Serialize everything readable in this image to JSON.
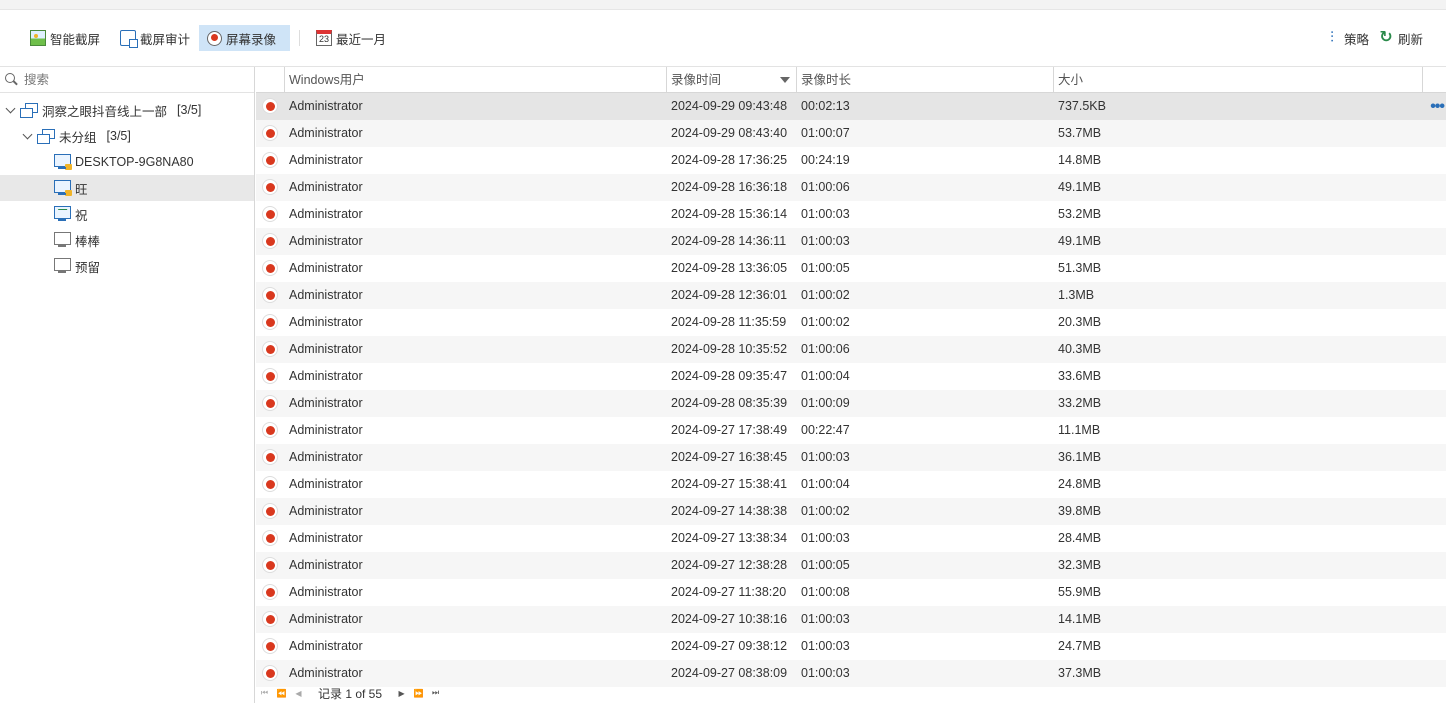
{
  "toolbar": {
    "smart_capture": "智能截屏",
    "capture_audit": "截屏审计",
    "screen_record": "屏幕录像",
    "date_range": "最近一月",
    "calendar_day": "23",
    "policy": "策略",
    "refresh": "刷新"
  },
  "sidebar": {
    "search_placeholder": "搜索",
    "root": {
      "label": "洞察之眼抖音线上一部",
      "count": "[3/5]"
    },
    "group": {
      "label": "未分组",
      "count": "[3/5]"
    },
    "computers": [
      {
        "label": "DESKTOP-9G8NA80",
        "state": "online-locked"
      },
      {
        "label": "旺",
        "state": "online-locked"
      },
      {
        "label": "祝",
        "state": "online-active"
      },
      {
        "label": "棒棒",
        "state": "offline"
      },
      {
        "label": "预留",
        "state": "offline"
      }
    ]
  },
  "table": {
    "columns": [
      "Windows用户",
      "录像时间",
      "录像时长",
      "大小"
    ],
    "rows": [
      [
        "Administrator",
        "2024-09-29 09:43:48",
        "00:02:13",
        "737.5KB"
      ],
      [
        "Administrator",
        "2024-09-29 08:43:40",
        "01:00:07",
        "53.7MB"
      ],
      [
        "Administrator",
        "2024-09-28 17:36:25",
        "00:24:19",
        "14.8MB"
      ],
      [
        "Administrator",
        "2024-09-28 16:36:18",
        "01:00:06",
        "49.1MB"
      ],
      [
        "Administrator",
        "2024-09-28 15:36:14",
        "01:00:03",
        "53.2MB"
      ],
      [
        "Administrator",
        "2024-09-28 14:36:11",
        "01:00:03",
        "49.1MB"
      ],
      [
        "Administrator",
        "2024-09-28 13:36:05",
        "01:00:05",
        "51.3MB"
      ],
      [
        "Administrator",
        "2024-09-28 12:36:01",
        "01:00:02",
        "1.3MB"
      ],
      [
        "Administrator",
        "2024-09-28 11:35:59",
        "01:00:02",
        "20.3MB"
      ],
      [
        "Administrator",
        "2024-09-28 10:35:52",
        "01:00:06",
        "40.3MB"
      ],
      [
        "Administrator",
        "2024-09-28 09:35:47",
        "01:00:04",
        "33.6MB"
      ],
      [
        "Administrator",
        "2024-09-28 08:35:39",
        "01:00:09",
        "33.2MB"
      ],
      [
        "Administrator",
        "2024-09-27 17:38:49",
        "00:22:47",
        "11.1MB"
      ],
      [
        "Administrator",
        "2024-09-27 16:38:45",
        "01:00:03",
        "36.1MB"
      ],
      [
        "Administrator",
        "2024-09-27 15:38:41",
        "01:00:04",
        "24.8MB"
      ],
      [
        "Administrator",
        "2024-09-27 14:38:38",
        "01:00:02",
        "39.8MB"
      ],
      [
        "Administrator",
        "2024-09-27 13:38:34",
        "01:00:03",
        "28.4MB"
      ],
      [
        "Administrator",
        "2024-09-27 12:38:28",
        "01:00:05",
        "32.3MB"
      ],
      [
        "Administrator",
        "2024-09-27 11:38:20",
        "01:00:08",
        "55.9MB"
      ],
      [
        "Administrator",
        "2024-09-27 10:38:16",
        "01:00:03",
        "14.1MB"
      ],
      [
        "Administrator",
        "2024-09-27 09:38:12",
        "01:00:03",
        "24.7MB"
      ],
      [
        "Administrator",
        "2024-09-27 08:38:09",
        "01:00:03",
        "37.3MB"
      ]
    ],
    "more_glyph": "•••"
  },
  "pager": {
    "status": "记录 1 of 55"
  }
}
